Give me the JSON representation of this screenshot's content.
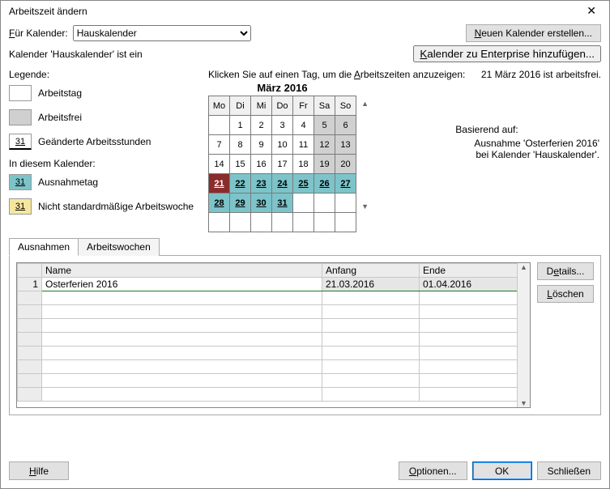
{
  "window": {
    "title": "Arbeitszeit ändern"
  },
  "topbar": {
    "for_calendar_label": "Für Kalender:",
    "for_calendar_label_u": "F",
    "selected_calendar": "Hauskalender",
    "new_calendar_btn": "Neuen Kalender erstellen...",
    "new_calendar_btn_u": "N",
    "calendar_is": "Kalender 'Hauskalender' ist ein",
    "add_enterprise_btn": "Kalender zu Enterprise hinzufügen...",
    "add_enterprise_btn_u": "K"
  },
  "legend": {
    "title": "Legende:",
    "workday": "Arbeitstag",
    "nonwork": "Arbeitsfrei",
    "edited": "Geänderte Arbeitsstunden",
    "edited_swatch": "31",
    "in_this": "In diesem Kalender:",
    "exception": "Ausnahmetag",
    "exception_swatch": "31",
    "nonstd": "Nicht standardmäßige Arbeitswoche",
    "nonstd_swatch": "31"
  },
  "calendar": {
    "click_hint": "Klicken Sie auf einen Tag, um die Arbeitszeiten anzuzeigen:",
    "click_hint_u": "A",
    "status_line": "21 März 2016 ist arbeitsfrei.",
    "month_label": "März 2016",
    "days": [
      "Mo",
      "Di",
      "Mi",
      "Do",
      "Fr",
      "Sa",
      "So"
    ],
    "weeks": [
      [
        {
          "n": "",
          "cls": "empty"
        },
        {
          "n": 1
        },
        {
          "n": 2
        },
        {
          "n": 3
        },
        {
          "n": 4
        },
        {
          "n": 5,
          "cls": "we"
        },
        {
          "n": 6,
          "cls": "we"
        }
      ],
      [
        {
          "n": 7
        },
        {
          "n": 8
        },
        {
          "n": 9
        },
        {
          "n": 10
        },
        {
          "n": 11
        },
        {
          "n": 12,
          "cls": "we"
        },
        {
          "n": 13,
          "cls": "we"
        }
      ],
      [
        {
          "n": 14
        },
        {
          "n": 15
        },
        {
          "n": 16
        },
        {
          "n": 17
        },
        {
          "n": 18
        },
        {
          "n": 19,
          "cls": "we"
        },
        {
          "n": 20,
          "cls": "we"
        }
      ],
      [
        {
          "n": 21,
          "cls": "sel"
        },
        {
          "n": 22,
          "cls": "ex"
        },
        {
          "n": 23,
          "cls": "ex"
        },
        {
          "n": 24,
          "cls": "ex"
        },
        {
          "n": 25,
          "cls": "ex"
        },
        {
          "n": 26,
          "cls": "ex"
        },
        {
          "n": 27,
          "cls": "ex"
        }
      ],
      [
        {
          "n": 28,
          "cls": "ex"
        },
        {
          "n": 29,
          "cls": "ex"
        },
        {
          "n": 30,
          "cls": "ex"
        },
        {
          "n": 31,
          "cls": "ex"
        },
        {
          "n": "",
          "cls": "empty"
        },
        {
          "n": "",
          "cls": "empty"
        },
        {
          "n": "",
          "cls": "empty"
        }
      ],
      [
        {
          "n": "",
          "cls": "empty"
        },
        {
          "n": "",
          "cls": "empty"
        },
        {
          "n": "",
          "cls": "empty"
        },
        {
          "n": "",
          "cls": "empty"
        },
        {
          "n": "",
          "cls": "empty"
        },
        {
          "n": "",
          "cls": "empty"
        },
        {
          "n": "",
          "cls": "empty"
        }
      ]
    ],
    "based_on_label": "Basierend auf:",
    "based_on_text1": "Ausnahme 'Osterferien 2016'",
    "based_on_text2": "bei Kalender 'Hauskalender'."
  },
  "tabs": {
    "exceptions": "Ausnahmen",
    "workweeks": "Arbeitswochen"
  },
  "grid": {
    "headers": {
      "name": "Name",
      "start": "Anfang",
      "end": "Ende"
    },
    "rows": [
      {
        "idx": "1",
        "name": "Osterferien 2016",
        "start": "21.03.2016",
        "end": "01.04.2016"
      }
    ]
  },
  "sidebtns": {
    "details": "Details...",
    "details_u": "e",
    "delete": "Löschen",
    "delete_u": "L"
  },
  "footer": {
    "help": "Hilfe",
    "help_u": "H",
    "options": "Optionen...",
    "options_u": "O",
    "ok": "OK",
    "close": "Schließen"
  }
}
